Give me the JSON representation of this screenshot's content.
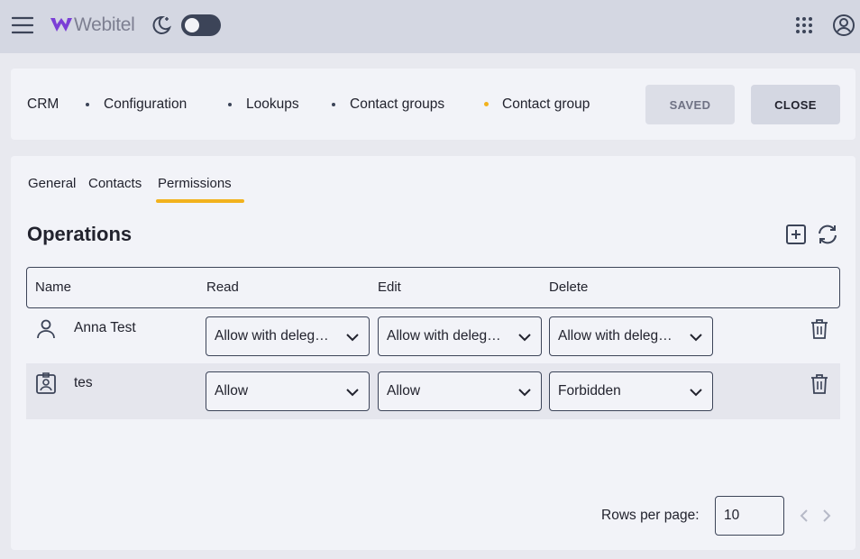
{
  "app": {
    "logo_text": "Webitel"
  },
  "breadcrumbs": [
    "CRM",
    "Configuration",
    "Lookups",
    "Contact groups",
    "Contact group"
  ],
  "actions": {
    "saved_label": "SAVED",
    "close_label": "CLOSE"
  },
  "tabs": [
    "General",
    "Contacts",
    "Permissions"
  ],
  "active_tab": "Permissions",
  "section": {
    "title": "Operations"
  },
  "table": {
    "columns": [
      "Name",
      "Read",
      "Edit",
      "Delete"
    ],
    "rows": [
      {
        "icon": "user-icon",
        "name": "Anna Test",
        "read": "Allow with delegation",
        "edit": "Allow with delegation",
        "delete": "Allow with delegation"
      },
      {
        "icon": "badge-icon",
        "name": "tes",
        "read": "Allow",
        "edit": "Allow",
        "delete": "Forbidden"
      }
    ]
  },
  "pagination": {
    "rows_per_page_label": "Rows per page:",
    "rows_per_page_value": "10"
  },
  "colors": {
    "accent": "#f2b21d",
    "topbar": "#d4d7e2",
    "dark": "#3c4458"
  }
}
